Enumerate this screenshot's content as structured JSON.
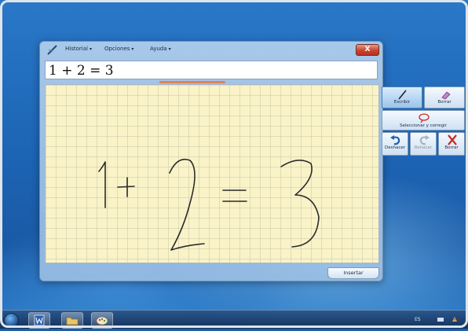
{
  "window": {
    "menus": [
      {
        "label": "Historial"
      },
      {
        "label": "Opciones"
      },
      {
        "label": "Ayuda"
      }
    ],
    "close_label": "X",
    "result_text": "1 + 2 = 3",
    "insert_label": "Insertar"
  },
  "tools": {
    "write_label": "Escribir",
    "erase_label": "Borrar",
    "select_label": "Seleccionar y corregir",
    "undo_label": "Deshacer",
    "redo_label": "Rehacer",
    "clear_label": "Borrar"
  },
  "taskbar": {
    "language": "ES"
  },
  "colors": {
    "close_red": "#c7452f",
    "pad_yellow": "#faf3c8",
    "progress_orange": "#e4805a",
    "undo_blue": "#1f5fb0",
    "clear_red": "#cc2a1e"
  },
  "icons": [
    "math-panel-icon",
    "pen-icon",
    "eraser-icon",
    "lasso-icon",
    "undo-icon",
    "redo-icon",
    "clear-x-icon",
    "start-orb-icon",
    "word-icon",
    "folder-icon",
    "paint-icon"
  ]
}
